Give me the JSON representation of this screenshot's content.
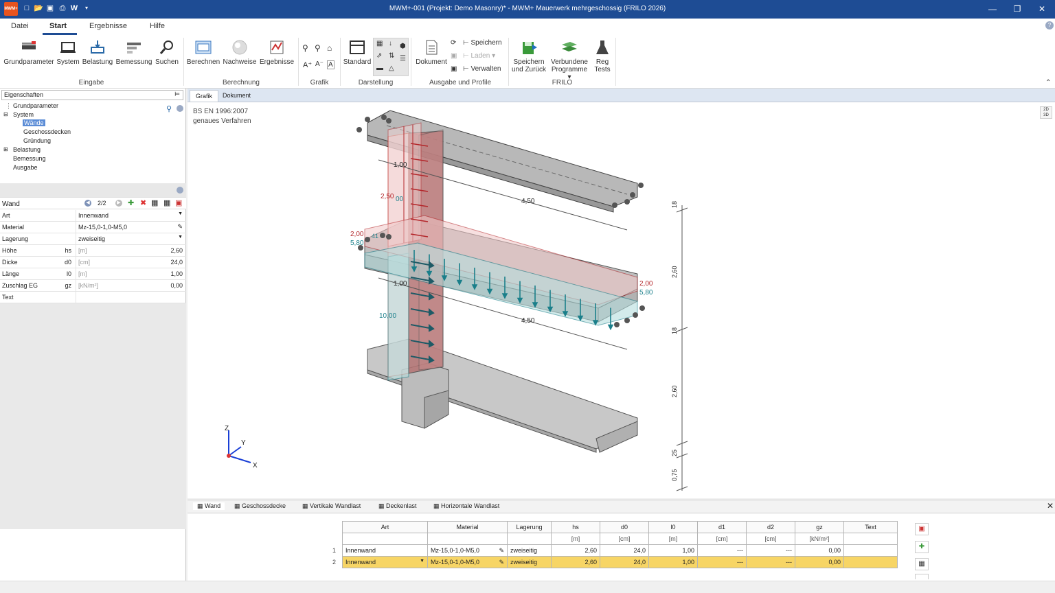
{
  "title": "MWM+-001 (Projekt: Demo Masonry)* - MWM+ Mauerwerk mehrgeschossig (FRILO 2026)",
  "logo_text": "MWM+",
  "quick_access": [
    "new-icon",
    "open-icon",
    "save-icon",
    "print-icon",
    "W",
    "customize-icon"
  ],
  "menu_tabs": [
    "Datei",
    "Start",
    "Ergebnisse",
    "Hilfe"
  ],
  "ribbon": {
    "eingabe": {
      "label": "Eingabe",
      "buttons": [
        "Grundparameter",
        "System",
        "Belastung",
        "Bemessung",
        "Suchen"
      ]
    },
    "berechnung": {
      "label": "Berechnung",
      "buttons": [
        "Berechnen",
        "Nachweise",
        "Ergebnisse"
      ]
    },
    "grafik": {
      "label": "Grafik"
    },
    "darstellung": {
      "label": "Darstellung",
      "standard": "Standard"
    },
    "ausgabe": {
      "label": "Ausgabe und Profile",
      "dokument": "Dokument",
      "speichern": "Speichern",
      "laden": "Laden",
      "verwalten": "Verwalten"
    },
    "frilo": {
      "label": "FRILO",
      "speichern_zurueck_1": "Speichern",
      "speichern_zurueck_2": "und Zurück",
      "verbundene_1": "Verbundene",
      "verbundene_2": "Programme",
      "reg_1": "Reg",
      "reg_2": "Tests"
    }
  },
  "left_panel": {
    "header": "Eigenschaften",
    "tree": [
      "Grundparameter",
      "System",
      "Wände",
      "Geschossdecken",
      "Gründung",
      "Belastung",
      "Bemessung",
      "Ausgabe"
    ],
    "wand_title": "Wand",
    "wand_counter": "2/2",
    "props": [
      {
        "label": "Art",
        "sym": "",
        "value": "Innenwand",
        "unit": "",
        "dropdown": true
      },
      {
        "label": "Material",
        "sym": "",
        "value": "Mz-15,0-1,0-M5,0",
        "unit": "",
        "dropdown": false
      },
      {
        "label": "Lagerung",
        "sym": "",
        "value": "zweiseitig",
        "unit": "",
        "dropdown": true
      },
      {
        "label": "Höhe",
        "sym": "hs",
        "value": "2,60",
        "unit": "[m]"
      },
      {
        "label": "Dicke",
        "sym": "d0",
        "value": "24,0",
        "unit": "[cm]"
      },
      {
        "label": "Länge",
        "sym": "l0",
        "value": "1,00",
        "unit": "[m]"
      },
      {
        "label": "Zuschlag EG",
        "sym": "gz",
        "value": "0,00",
        "unit": "[kN/m²]"
      },
      {
        "label": "Text",
        "sym": "",
        "value": "",
        "unit": ""
      }
    ]
  },
  "graphic": {
    "tabs": [
      "Grafik",
      "Dokument"
    ],
    "info1": "BS EN 1996:2007",
    "info2": "genaues Verfahren",
    "view_toggle_2d": "2D",
    "view_toggle_3d": "3D",
    "labels": {
      "top_load_1": "1,00",
      "top_load_2": "2,50",
      "top_load_3": "00",
      "mid_left_1": "2,00",
      "mid_left_2": "5,80",
      "mid_right_1": "2,00",
      "mid_right_2": "5,80",
      "mid_41": "41",
      "lower_1": "1,00",
      "lower_10": "10,00",
      "span_top": "4,50",
      "span_mid": "4,50",
      "dim_18a": "18",
      "dim_260a": "2,60",
      "dim_18b": "18",
      "dim_260b": "2,60",
      "dim_25": "25",
      "dim_075": "0,75"
    },
    "axes": {
      "z": "Z",
      "y": "Y",
      "x": "X"
    }
  },
  "bottom_tabs": [
    "Wand",
    "Geschossdecke",
    "Vertikale Wandlast",
    "Deckenlast",
    "Horizontale Wandlast"
  ],
  "table": {
    "headers": [
      "Art",
      "Material",
      "Lagerung",
      "hs",
      "d0",
      "l0",
      "d1",
      "d2",
      "gz",
      "Text"
    ],
    "units": [
      "",
      "",
      "",
      "[m]",
      "[cm]",
      "[m]",
      "[cm]",
      "[cm]",
      "[kN/m²]",
      ""
    ],
    "rows": [
      {
        "nr": "1",
        "art": "Innenwand",
        "material": "Mz-15,0-1,0-M5,0",
        "lagerung": "zweiseitig",
        "hs": "2,60",
        "d0": "24,0",
        "l0": "1,00",
        "d1": "---",
        "d2": "---",
        "gz": "0,00",
        "text": ""
      },
      {
        "nr": "2",
        "art": "Innenwand",
        "material": "Mz-15,0-1,0-M5,0",
        "lagerung": "zweiseitig",
        "hs": "2,60",
        "d0": "24,0",
        "l0": "1,00",
        "d1": "---",
        "d2": "---",
        "gz": "0,00",
        "text": ""
      }
    ]
  },
  "colors": {
    "titlebar": "#1e4c94",
    "selected_row": "#f7d565",
    "load_red": "#b3262a",
    "load_teal": "#1a7f8a",
    "wall_gray": "#a0a0a0"
  }
}
